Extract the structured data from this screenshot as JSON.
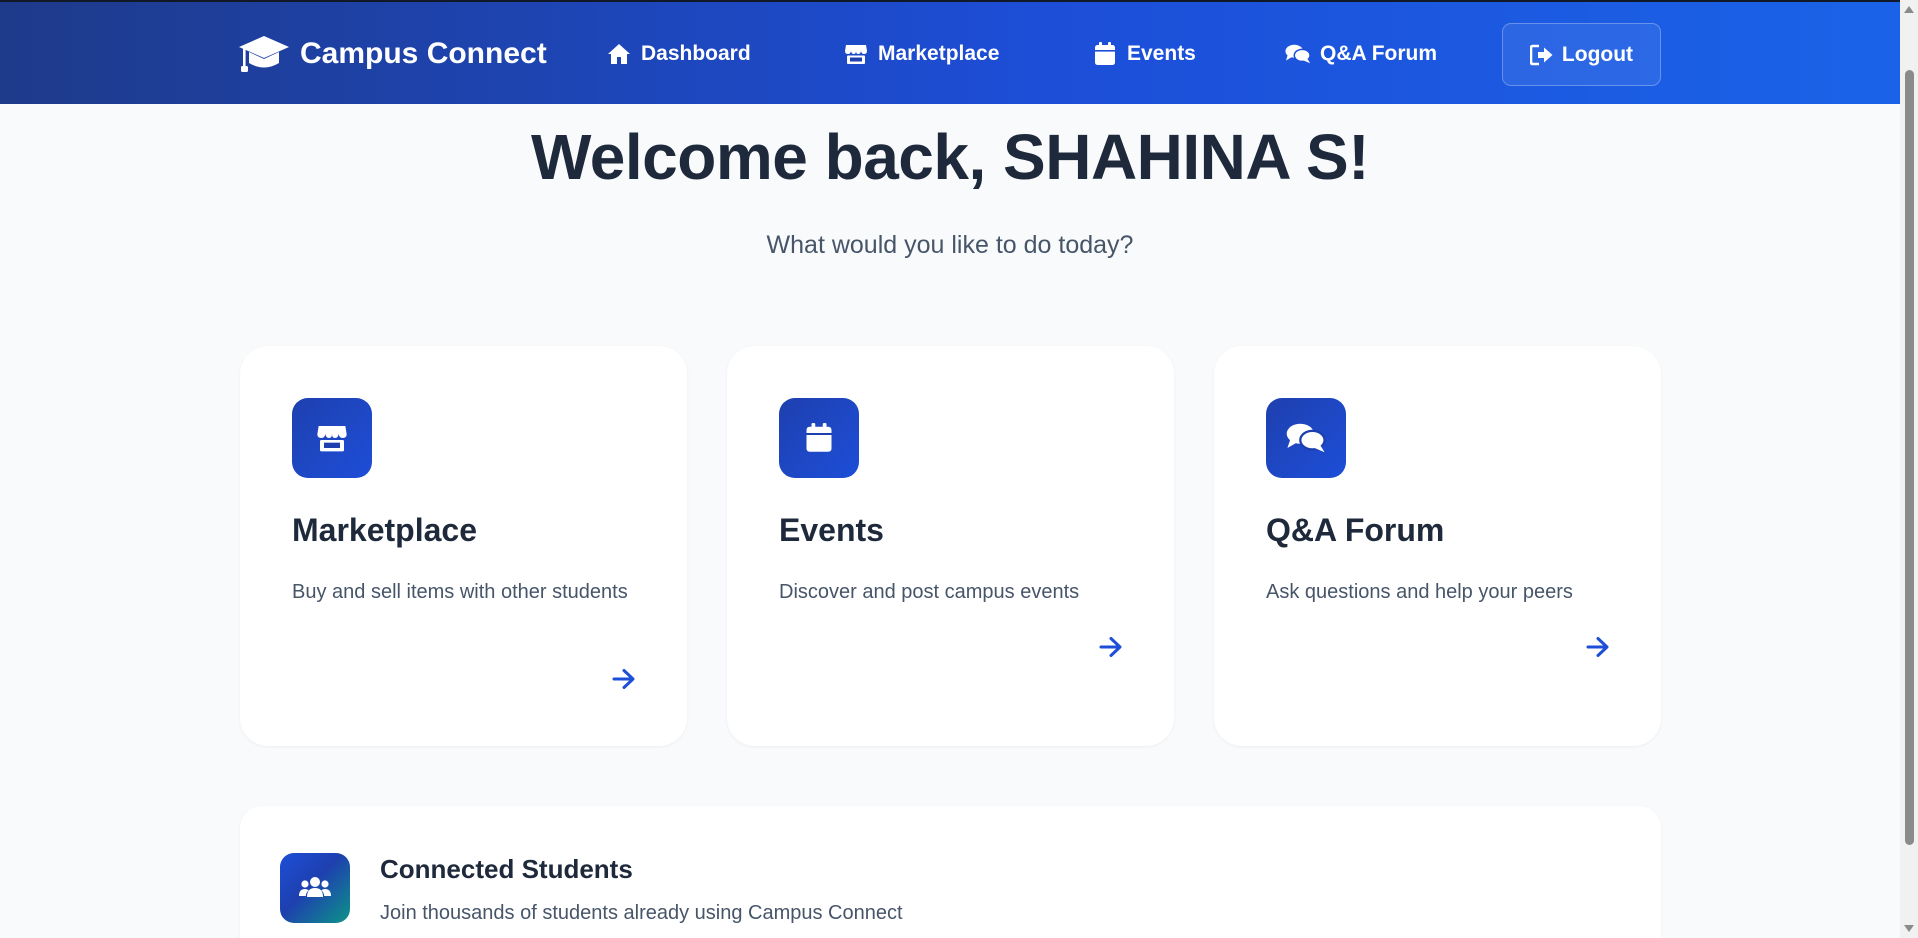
{
  "navbar": {
    "brand": {
      "label": "Campus Connect",
      "icon": "graduation-cap-icon"
    },
    "links": [
      {
        "label": "Dashboard",
        "icon": "home-icon"
      },
      {
        "label": "Marketplace",
        "icon": "store-icon"
      },
      {
        "label": "Events",
        "icon": "calendar-icon"
      },
      {
        "label": "Q&A Forum",
        "icon": "comments-icon"
      }
    ],
    "logout": {
      "label": "Logout",
      "icon": "sign-out-icon"
    }
  },
  "hero": {
    "welcome": "Welcome back, SHAHINA S!",
    "subtitle": "What would you like to do today?"
  },
  "cards": [
    {
      "title": "Marketplace",
      "description": "Buy and sell items with other students",
      "icon": "store-icon",
      "arrow_icon": "arrow-right-icon"
    },
    {
      "title": "Events",
      "description": "Discover and post campus events",
      "icon": "calendar-icon",
      "arrow_icon": "arrow-right-icon"
    },
    {
      "title": "Q&A Forum",
      "description": "Ask questions and help your peers",
      "icon": "comments-icon",
      "arrow_icon": "arrow-right-icon"
    }
  ],
  "stats": {
    "title": "Connected Students",
    "description": "Join thousands of students already using Campus Connect",
    "icon": "users-icon"
  },
  "colors": {
    "nav_gradient_start": "#1e3a8a",
    "nav_gradient_end": "#1a63e8",
    "accent": "#1d4ed8",
    "page_background": "#f8fafc",
    "text_dark": "#1e293b",
    "text_muted": "#475569"
  }
}
